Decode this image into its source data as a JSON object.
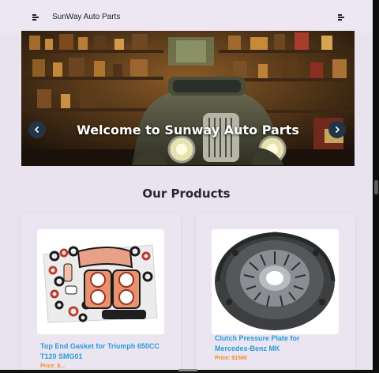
{
  "header": {
    "brand": "SunWay Auto Parts",
    "left_icon": "menu-icon",
    "right_icon": "menu-icon"
  },
  "hero": {
    "title": "Welcome to Sunway Auto Parts",
    "prev_icon": "chevron-left-icon",
    "next_icon": "chevron-right-icon"
  },
  "products_section": {
    "title": "Our Products",
    "items": [
      {
        "name": "Top End Gasket for Triumph 650CC T120 SMG01",
        "price": "Price: $..."
      },
      {
        "name": "Clutch Pressure Plate for Mercedes-Benz MK",
        "price": "Price: $1500"
      }
    ]
  },
  "colors": {
    "page_bg": "#e8e3ee",
    "accent_link": "#2a9bd8",
    "price": "#f08b1e",
    "carousel_button": "#243447"
  }
}
